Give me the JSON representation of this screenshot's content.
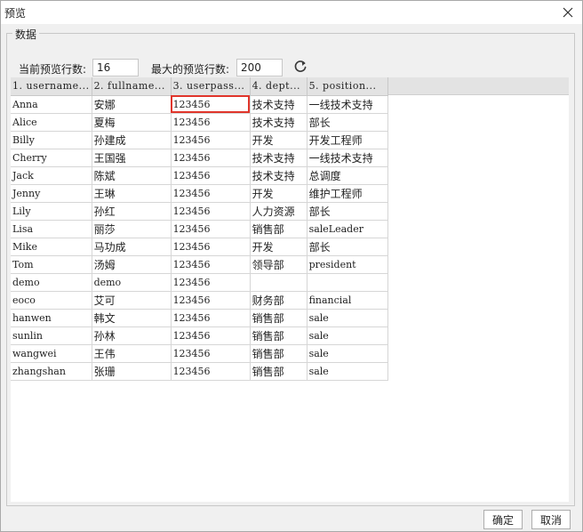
{
  "window": {
    "title": "预览"
  },
  "group": {
    "legend": "数据"
  },
  "controls": {
    "current_rows_label": "当前预览行数:",
    "current_rows_value": "16",
    "max_rows_label": "最大的预览行数:",
    "max_rows_value": "200"
  },
  "table": {
    "columns": [
      "1. username...",
      "2. fullname...",
      "3. userpass...",
      "4. dept...",
      "5. position..."
    ],
    "rows": [
      [
        "Anna",
        "安娜",
        "123456",
        "技术支持",
        "一线技术支持"
      ],
      [
        "Alice",
        "夏梅",
        "123456",
        "技术支持",
        "部长"
      ],
      [
        "Billy",
        "孙建成",
        "123456",
        "开发",
        "开发工程师"
      ],
      [
        "Cherry",
        "王国强",
        "123456",
        "技术支持",
        "一线技术支持"
      ],
      [
        "Jack",
        "陈斌",
        "123456",
        "技术支持",
        "总调度"
      ],
      [
        "Jenny",
        "王琳",
        "123456",
        "开发",
        "维护工程师"
      ],
      [
        "Lily",
        "孙红",
        "123456",
        "人力资源",
        "部长"
      ],
      [
        "Lisa",
        "丽莎",
        "123456",
        "销售部",
        "saleLeader"
      ],
      [
        "Mike",
        "马功成",
        "123456",
        "开发",
        "部长"
      ],
      [
        "Tom",
        "汤姆",
        "123456",
        "领导部",
        "president"
      ],
      [
        "demo",
        "demo",
        "123456",
        "",
        ""
      ],
      [
        "eoco",
        "艾可",
        "123456",
        "财务部",
        "financial"
      ],
      [
        "hanwen",
        "韩文",
        "123456",
        "销售部",
        "sale"
      ],
      [
        "sunlin",
        "孙林",
        "123456",
        "销售部",
        "sale"
      ],
      [
        "wangwei",
        "王伟",
        "123456",
        "销售部",
        "sale"
      ],
      [
        "zhangshan",
        "张珊",
        "123456",
        "销售部",
        "sale"
      ]
    ],
    "selected_cell": {
      "row": 0,
      "col": 2
    }
  },
  "buttons": {
    "ok": "确定",
    "cancel": "取消"
  },
  "colors": {
    "selection_outline": "#e0352b",
    "header_bg": "#e3e3e3",
    "dialog_bg": "#f0f0f0"
  },
  "icons": {
    "close": "close-icon",
    "refresh": "refresh-icon"
  }
}
